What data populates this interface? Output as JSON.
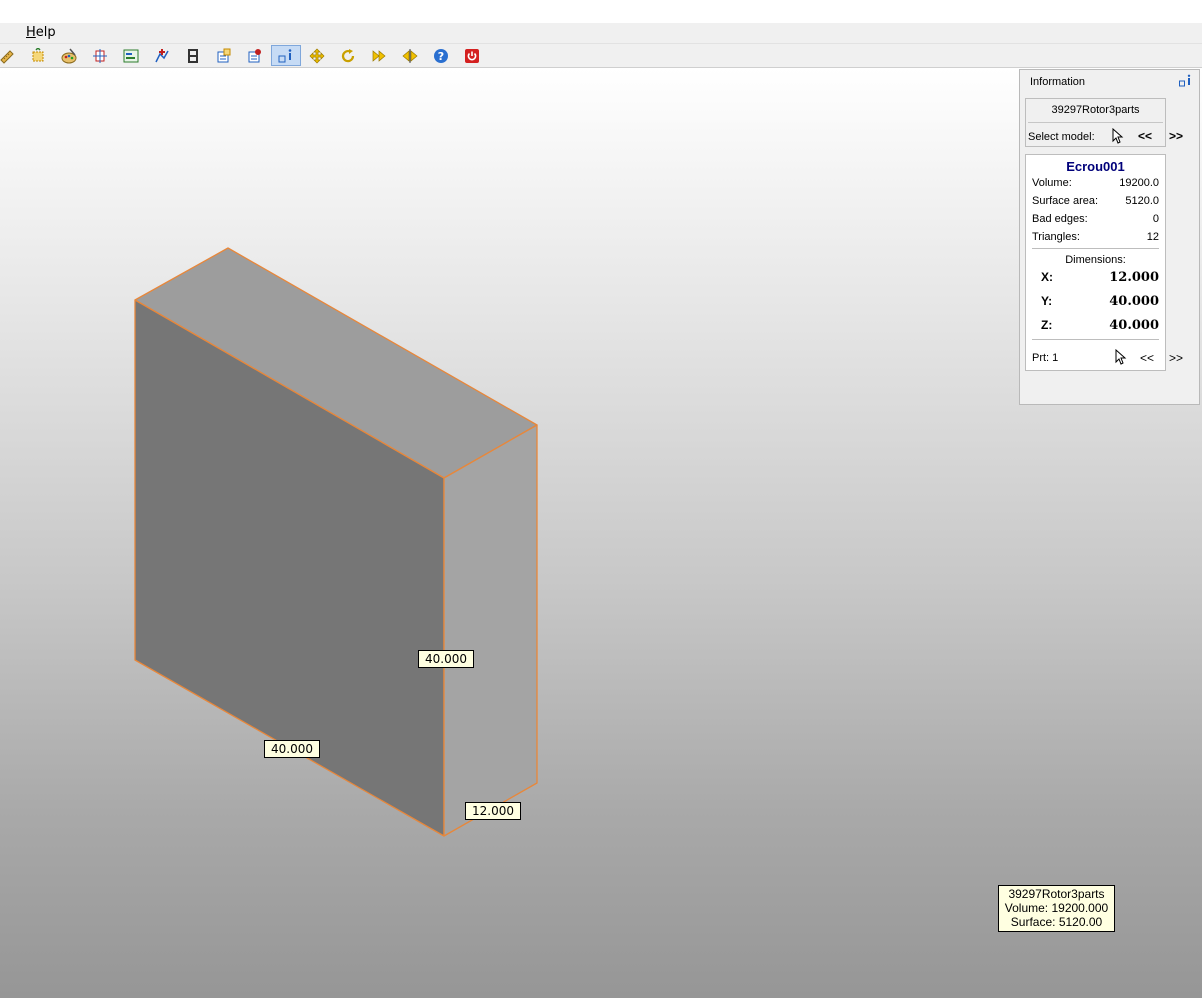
{
  "menu": {
    "help_accel": "H",
    "help_rest": "elp"
  },
  "toolbar": {
    "icons": [
      "ruler-icon",
      "select-box-icon",
      "paint-icon",
      "transform-icon",
      "layers-icon",
      "add-points-icon",
      "film-icon",
      "properties-icon",
      "settings-icon",
      "info-icon",
      "move-icon",
      "rotate-icon",
      "fast-forward-icon",
      "mirror-icon",
      "help-icon",
      "power-icon"
    ],
    "active_icon": "info-icon"
  },
  "viewport": {
    "dimension_labels": {
      "height": "40.000",
      "width": "40.000",
      "depth": "12.000"
    },
    "tooltip": {
      "model_name": "39297Rotor3parts",
      "volume": "Volume: 19200.000",
      "surface": "Surface: 5120.00"
    },
    "colors": {
      "edge": "#e8873a",
      "top_face": "#9d9d9d",
      "front_face": "#767676",
      "side_face": "#a4a4a4"
    }
  },
  "info_panel": {
    "title": "Information",
    "model_name": "39297Rotor3parts",
    "select_model_label": "Select model:",
    "prev_label": "<<",
    "next_label": ">>",
    "part": {
      "name": "Ecrou001",
      "properties": [
        {
          "key": "Volume:",
          "value": "19200.0"
        },
        {
          "key": "Surface area:",
          "value": "5120.0"
        },
        {
          "key": "Bad edges:",
          "value": "0"
        },
        {
          "key": "Triangles:",
          "value": "12"
        }
      ],
      "dimensions_title": "Dimensions:",
      "dimensions": [
        {
          "axis": "X:",
          "value": "12.000"
        },
        {
          "axis": "Y:",
          "value": "40.000"
        },
        {
          "axis": "Z:",
          "value": "40.000"
        }
      ],
      "part_label": "Prt: 1",
      "prev_label": "<<",
      "next_label": ">>"
    }
  }
}
